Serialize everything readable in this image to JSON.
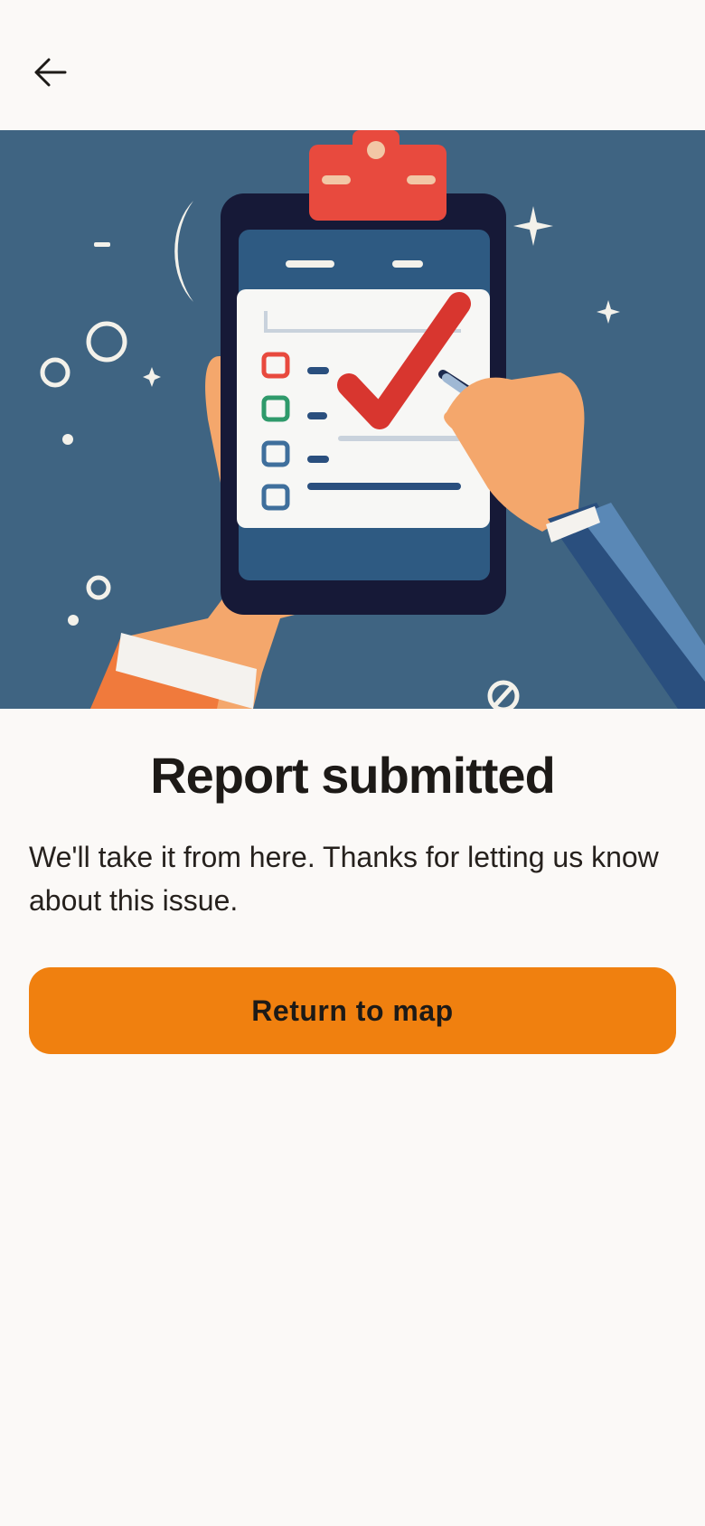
{
  "header": {
    "back_icon": "arrow-left-icon"
  },
  "hero": {
    "illustration": "clipboard-checklist-illustration"
  },
  "confirmation": {
    "title": "Report submitted",
    "message": "We'll take it from here. Thanks for letting us know about this issue."
  },
  "actions": {
    "return_label": "Return to map"
  },
  "colors": {
    "background": "#fbf9f7",
    "accent": "#f0800f",
    "hero_background": "#3f6482",
    "text": "#1d1a17"
  }
}
